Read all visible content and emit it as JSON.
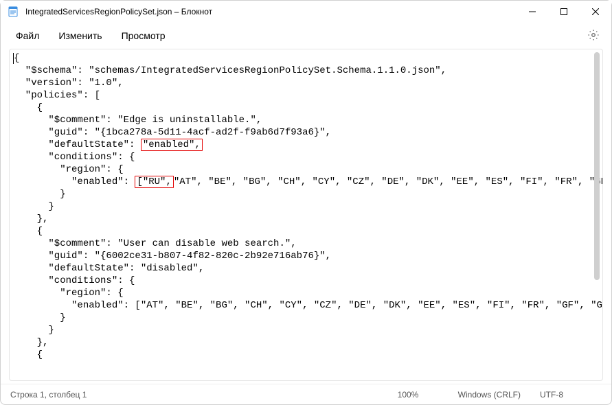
{
  "window": {
    "title": "IntegratedServicesRegionPolicySet.json – Блокнот"
  },
  "menu": {
    "file": "Файл",
    "edit": "Изменить",
    "view": "Просмотр"
  },
  "code": {
    "l1": "{",
    "l2": "  \"$schema\": \"schemas/IntegratedServicesRegionPolicySet.Schema.1.1.0.json\",",
    "l3": "  \"version\": \"1.0\",",
    "l4": "  \"policies\": [",
    "l5": "    {",
    "l6": "      \"$comment\": \"Edge is uninstallable.\",",
    "l7": "      \"guid\": \"{1bca278a-5d11-4acf-ad2f-f9ab6d7f93a6}\",",
    "l8a": "      \"defaultState\": ",
    "l8_box": "\"enabled\",",
    "l9": "      \"conditions\": {",
    "l10": "        \"region\": {",
    "l11a": "          \"enabled\": ",
    "l11_box": "[\"RU\",",
    "l11b": "\"AT\", \"BE\", \"BG\", \"CH\", \"CY\", \"CZ\", \"DE\", \"DK\", \"EE\", \"ES\", \"FI\", \"FR\", \"GF\", \"G",
    "l12": "        }",
    "l13": "      }",
    "l14": "    },",
    "l15": "    {",
    "l16": "      \"$comment\": \"User can disable web search.\",",
    "l17": "      \"guid\": \"{6002ce31-b807-4f82-820c-2b92e716ab76}\",",
    "l18": "      \"defaultState\": \"disabled\",",
    "l19": "      \"conditions\": {",
    "l20": "        \"region\": {",
    "l21": "          \"enabled\": [\"AT\", \"BE\", \"BG\", \"CH\", \"CY\", \"CZ\", \"DE\", \"DK\", \"EE\", \"ES\", \"FI\", \"FR\", \"GF\", \"GP\", \"",
    "l22": "        }",
    "l23": "      }",
    "l24": "    },",
    "l25": "    {"
  },
  "status": {
    "position": "Строка 1, столбец 1",
    "zoom": "100%",
    "lineending": "Windows (CRLF)",
    "encoding": "UTF-8"
  }
}
